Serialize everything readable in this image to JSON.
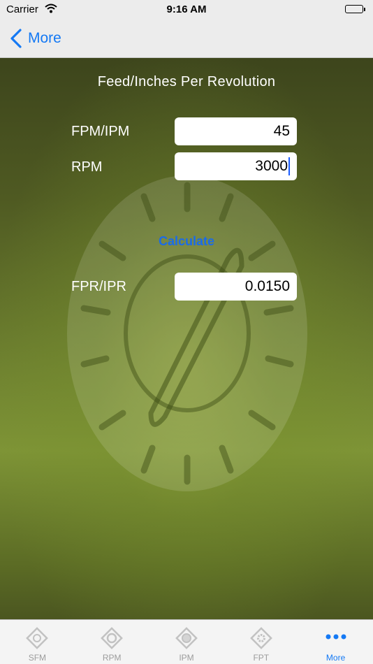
{
  "status_bar": {
    "carrier": "Carrier",
    "time": "9:16 AM"
  },
  "nav": {
    "back_label": "More"
  },
  "screen": {
    "title": "Feed/Inches Per Revolution",
    "fields": [
      {
        "label": "FPM/IPM",
        "value": "45"
      },
      {
        "label": "RPM",
        "value": "3000"
      }
    ],
    "calculate_label": "Calculate",
    "result": {
      "label": "FPR/IPR",
      "value": "0.0150"
    }
  },
  "tabs": [
    {
      "label": "SFM",
      "icon": "sfm-icon"
    },
    {
      "label": "RPM",
      "icon": "rpm-icon"
    },
    {
      "label": "IPM",
      "icon": "ipm-icon"
    },
    {
      "label": "FPT",
      "icon": "fpt-icon"
    },
    {
      "label": "More",
      "icon": "more-dots-icon",
      "active": true
    }
  ],
  "colors": {
    "accent": "#1479f4",
    "calculate": "#1a6be8",
    "background_green": "#6f8230"
  }
}
